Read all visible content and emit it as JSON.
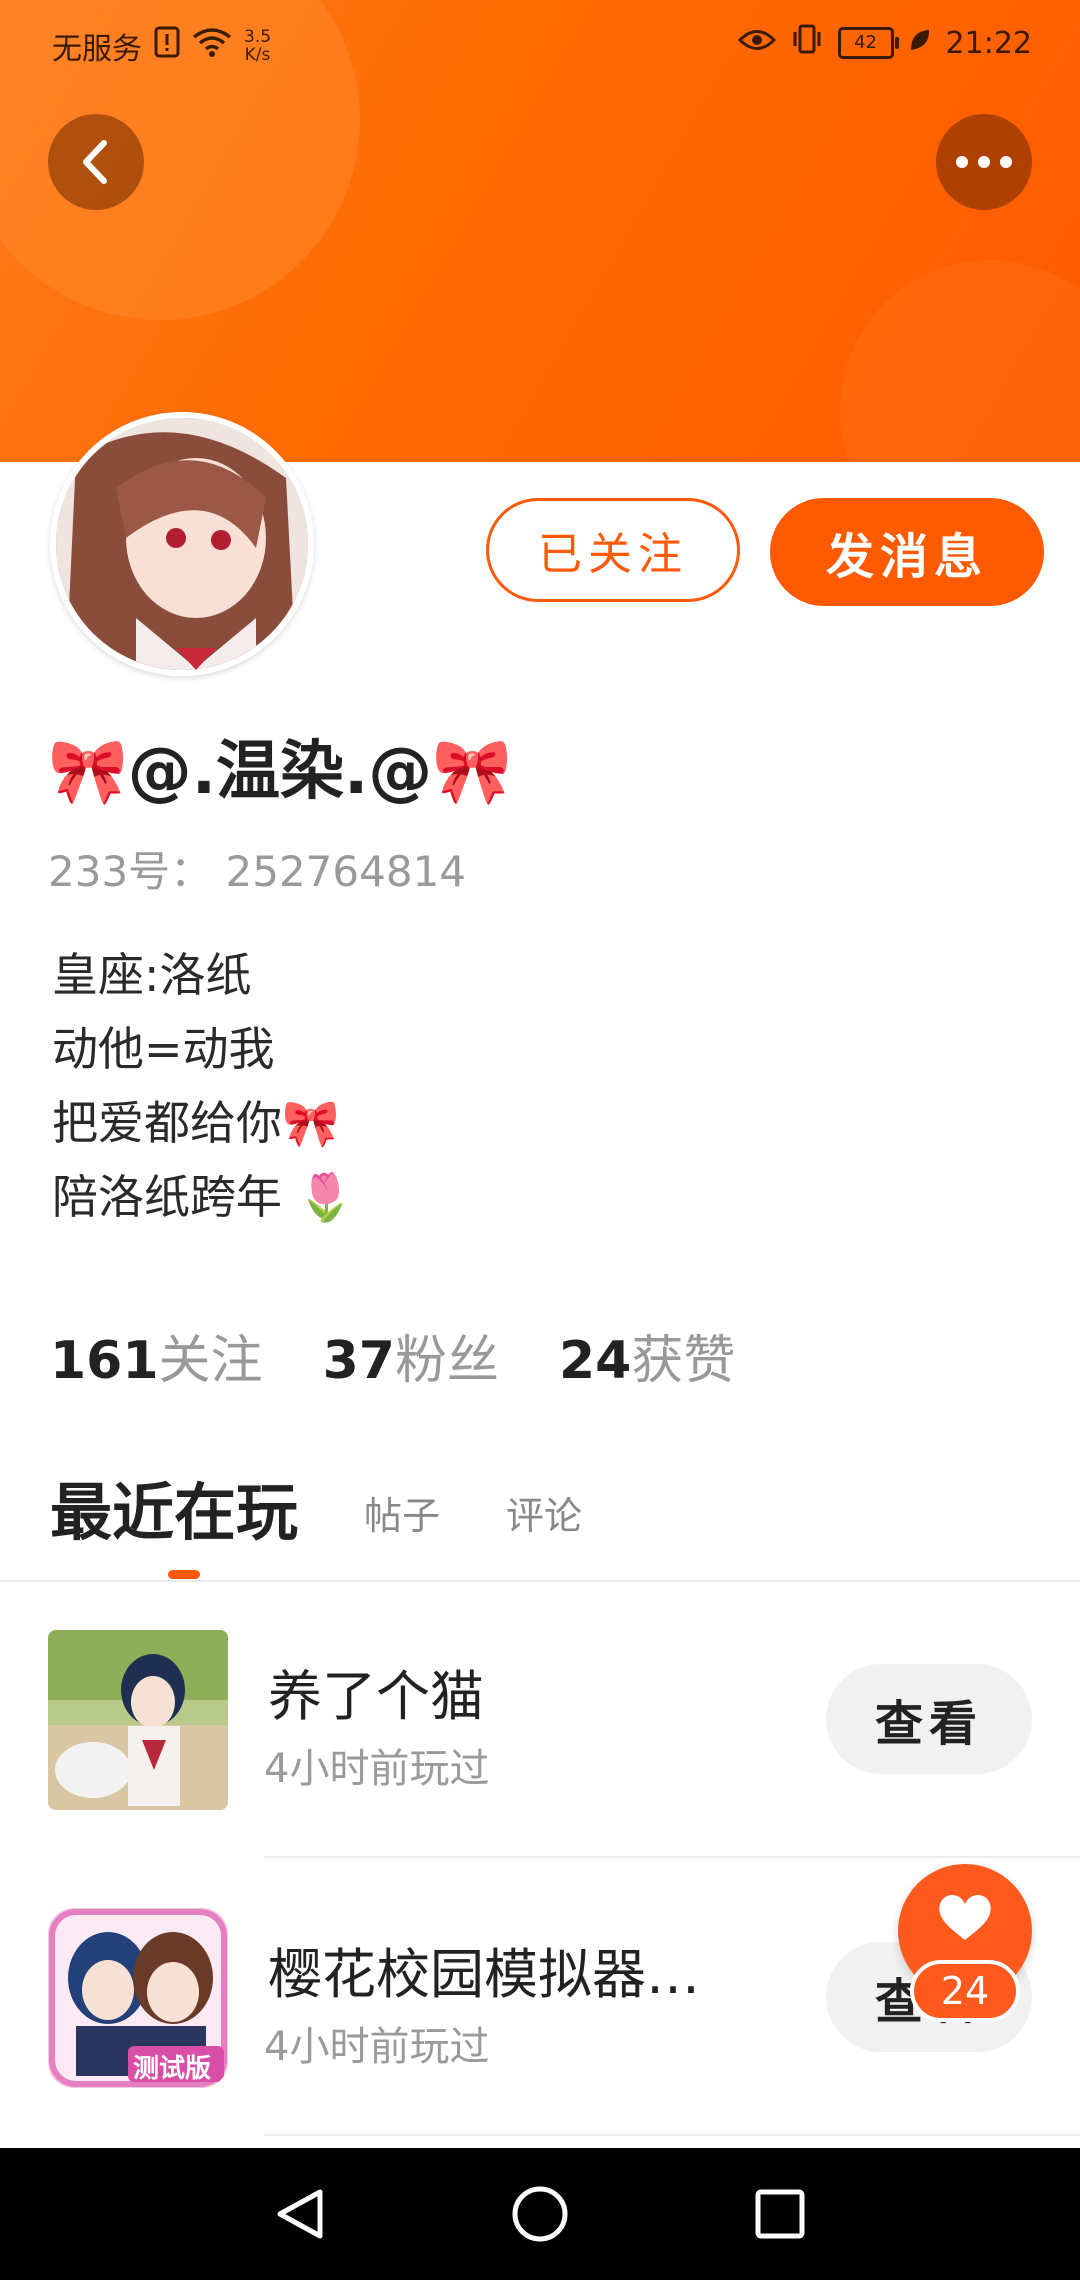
{
  "status_bar": {
    "carrier": "无服务",
    "speed_value": "3.5",
    "speed_unit": "K/s",
    "battery": "42",
    "time": "21:22"
  },
  "header": {
    "back_icon": "chevron-left-icon",
    "more_icon": "more-horizontal-icon",
    "accent_color": "#ff6a00"
  },
  "profile": {
    "follow_label": "已关注",
    "message_label": "发消息",
    "nickname": "🎀@.温染.@🎀",
    "uid": "233号：  252764814",
    "bio": [
      "皇座:洛纸",
      "动他=动我",
      "把爱都给你🎀",
      "陪洛纸跨年 🌷"
    ]
  },
  "stats": [
    {
      "num": "161",
      "label": "关注"
    },
    {
      "num": "37",
      "label": "粉丝"
    },
    {
      "num": "24",
      "label": "获赞"
    }
  ],
  "tabs": {
    "active": "最近在玩",
    "items": [
      "帖子",
      "评论"
    ]
  },
  "games": [
    {
      "name": "养了个猫",
      "time": "4小时前玩过",
      "button": "查看"
    },
    {
      "name": "樱花校园模拟器…",
      "time": "4小时前玩过",
      "button": "查看",
      "badge": "测试版"
    }
  ],
  "like_fab": {
    "count": "24"
  }
}
